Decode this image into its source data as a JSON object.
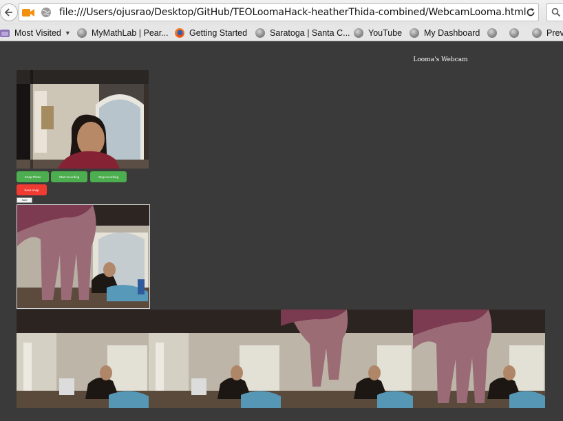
{
  "browser": {
    "url": "file:///Users/ojusrao/Desktop/GitHub/TEOLoomaHack-heatherThida-combined/WebcamLooma.html",
    "bookmarks": [
      {
        "label": "Most Visited",
        "icon": "most-visited-folder-icon"
      },
      {
        "label": "MyMathLab | Pear...",
        "icon": "globe-icon"
      },
      {
        "label": "Getting Started",
        "icon": "firefox-icon"
      },
      {
        "label": "Saratoga | Santa C...",
        "icon": "globe-icon"
      },
      {
        "label": "YouTube",
        "icon": "globe-icon"
      },
      {
        "label": "My Dashboard",
        "icon": "globe-icon"
      },
      {
        "label": "",
        "icon": "globe-icon"
      },
      {
        "label": "",
        "icon": "globe-icon"
      },
      {
        "label": "Prev",
        "icon": "globe-icon"
      }
    ]
  },
  "page": {
    "title": "Looma's Webcam",
    "buttons": {
      "snap_photo": "Snap Photo",
      "start_recording": "Start recording",
      "stop_recording": "Stop recording",
      "save_snap": "Save snap",
      "small": "Save"
    },
    "thumbnail_count": 4
  },
  "colors": {
    "page_background": "#3a3a3a",
    "button_green": "#4cae4f",
    "button_red": "#f03b32"
  }
}
